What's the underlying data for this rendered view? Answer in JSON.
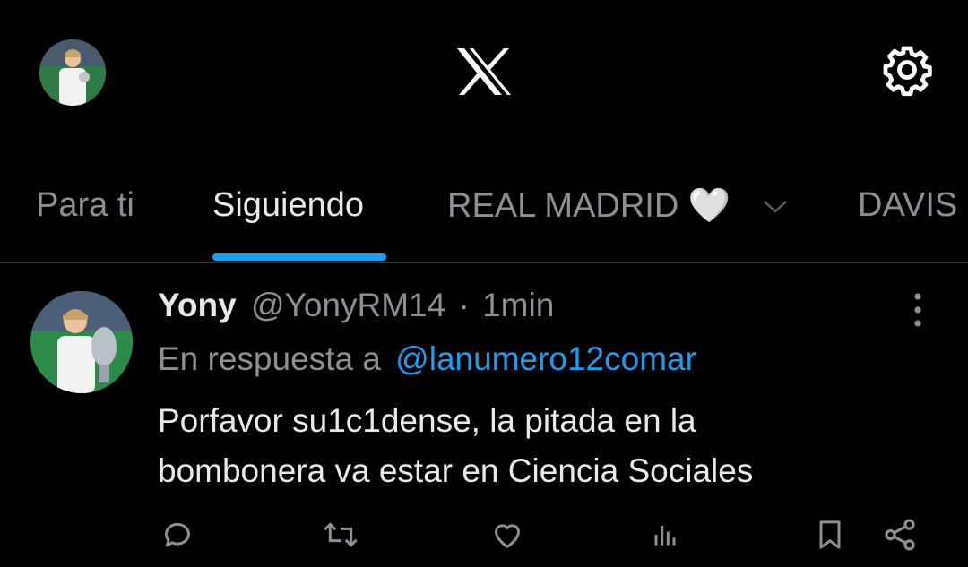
{
  "header": {
    "logo_icon": "x-logo-icon",
    "settings_icon": "gear-icon"
  },
  "tabs": [
    {
      "label": "Para ti",
      "active": false
    },
    {
      "label": "Siguiendo",
      "active": true
    },
    {
      "label": "REAL MADRID 🤍",
      "active": false
    },
    {
      "label": "DAVIS",
      "active": false
    }
  ],
  "tweet": {
    "display_name": "Yony",
    "handle": "@YonyRM14",
    "separator": "·",
    "time": "1min",
    "reply_prefix": "En respuesta a",
    "reply_to": "@lanumero12comar",
    "text_line1": "Porfavor su1c1dense, la pitada en la",
    "text_line2": "bombonera va estar en Ciencia Sociales"
  },
  "colors": {
    "background": "#000000",
    "accent": "#1d9bf0",
    "muted": "#8b9095",
    "text": "#e7e9ea"
  }
}
